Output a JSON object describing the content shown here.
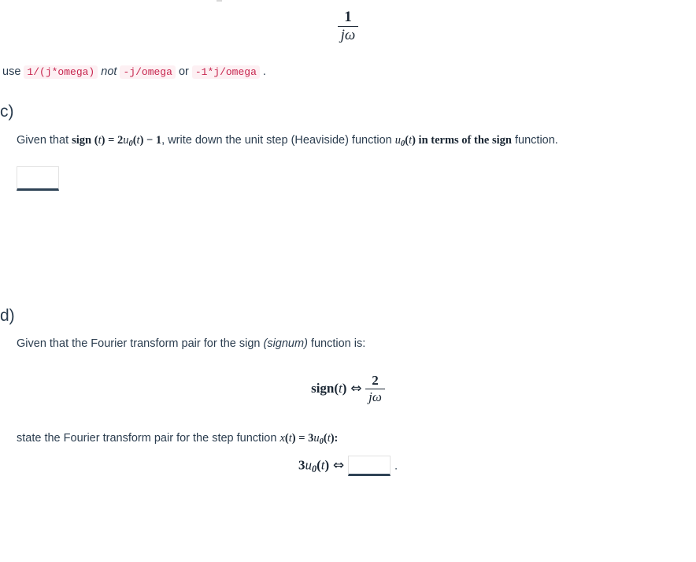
{
  "top_expression": {
    "numerator": "1",
    "denominator": "jω"
  },
  "hint": {
    "prefix": "use",
    "code_correct": "1/(j*omega)",
    "emphasis": "not",
    "code_wrong_1": "-j/omega",
    "conjunction": "or",
    "code_wrong_2": "-1*j/omega",
    "terminator": "."
  },
  "part_c": {
    "label": "c)",
    "prompt_segments": {
      "s1": "Given that ",
      "sign_word": "sign",
      "s2": " (",
      "var_t_1": "t",
      "s3": ") = 2",
      "u_symbol": "u",
      "u_subscript": "0",
      "s4": "(",
      "var_t_2": "t",
      "s5": ") − 1",
      "s6": ", write down the unit step (Heaviside) function ",
      "u_symbol_2": "u",
      "u_subscript_2": "0",
      "s7": "(",
      "var_t_3": "t",
      "s8": ") in terms of the ",
      "sign_word_2": "sign",
      "s9": " function."
    },
    "answer_value": "",
    "answer_placeholder": ""
  },
  "part_d": {
    "label": "d)",
    "prompt_segments": {
      "s1": "Given that the Fourier transform pair for the sign ",
      "signum": "(signum)",
      "s2": " function is:"
    },
    "given_pair": {
      "lhs_func": "sign",
      "lhs_open": "(",
      "lhs_var": "t",
      "lhs_close": ")",
      "arrow": "⇔",
      "rhs_numerator": "2",
      "rhs_denominator": "jω"
    },
    "statement_segments": {
      "s1": "state the Fourier transform pair for the step function ",
      "var_x": "x",
      "s2": "(",
      "var_t_1": "t",
      "s3": ") = 3",
      "u_symbol": "u",
      "u_subscript": "0",
      "s4": "(",
      "var_t_2": "t",
      "s5": "):"
    },
    "answer_pair": {
      "coefficient": "3",
      "u_symbol": "u",
      "u_subscript": "0",
      "open": "(",
      "var_t": "t",
      "close": ")",
      "arrow": "⇔",
      "terminator": "."
    },
    "answer_value": "",
    "answer_placeholder": ""
  },
  "colors": {
    "text": "#2b3d4f",
    "math": "#1a2633",
    "code_text": "#c7254e",
    "code_background": "#fdf0f3",
    "input_border": "#e2e2e2",
    "input_underline": "#2f4356",
    "page_background": "#ffffff"
  }
}
